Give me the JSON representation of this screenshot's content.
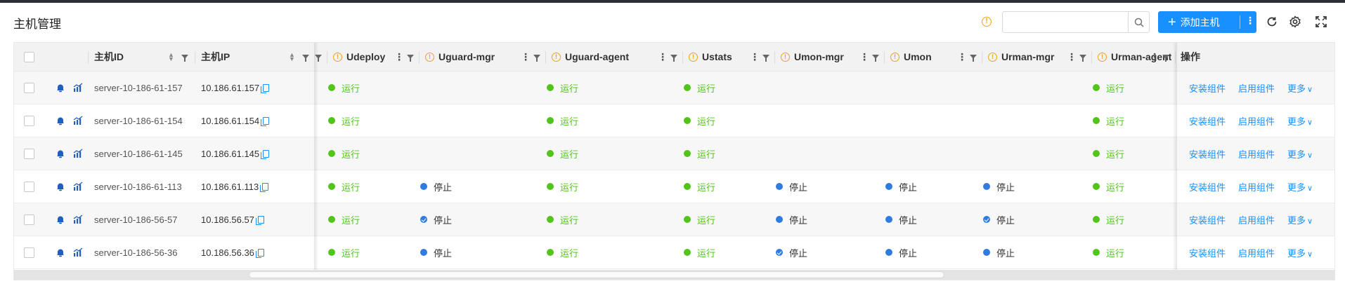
{
  "title": "主机管理",
  "toolbar": {
    "info_icon": "info-icon",
    "search": {
      "value": "",
      "placeholder": ""
    },
    "add_label": "添加主机",
    "add_more": "⋮"
  },
  "columns": {
    "host_id": "主机ID",
    "host_ip": "主机IP",
    "components": [
      "Udeploy",
      "Uguard-mgr",
      "Uguard-agent",
      "Ustats",
      "Umon-mgr",
      "Umon",
      "Urman-mgr",
      "Urman-agent"
    ],
    "actions": "操作"
  },
  "rows": [
    {
      "id": "server-10-186-61-157",
      "ip": "10.186.61.157",
      "status": [
        "运行",
        "",
        "运行",
        "运行",
        "",
        "",
        "",
        "运行"
      ],
      "kind": [
        "run",
        "",
        "run",
        "run",
        "",
        "",
        "",
        "run"
      ]
    },
    {
      "id": "server-10-186-61-154",
      "ip": "10.186.61.154",
      "status": [
        "运行",
        "",
        "运行",
        "运行",
        "",
        "",
        "",
        "运行"
      ],
      "kind": [
        "run",
        "",
        "run",
        "run",
        "",
        "",
        "",
        "run"
      ]
    },
    {
      "id": "server-10-186-61-145",
      "ip": "10.186.61.145",
      "status": [
        "运行",
        "",
        "运行",
        "运行",
        "",
        "",
        "",
        "运行"
      ],
      "kind": [
        "run",
        "",
        "run",
        "run",
        "",
        "",
        "",
        "run"
      ]
    },
    {
      "id": "server-10-186-61-113",
      "ip": "10.186.61.113",
      "status": [
        "运行",
        "停止",
        "运行",
        "运行",
        "停止",
        "停止",
        "停止",
        "运行"
      ],
      "kind": [
        "run",
        "stop",
        "run",
        "run",
        "stop",
        "stop",
        "stop",
        "run"
      ]
    },
    {
      "id": "server-10-186-56-57",
      "ip": "10.186.56.57",
      "status": [
        "运行",
        "停止",
        "运行",
        "运行",
        "停止",
        "停止",
        "停止",
        "运行"
      ],
      "kind": [
        "run",
        "check",
        "run",
        "run",
        "stop",
        "stop",
        "check",
        "run"
      ]
    },
    {
      "id": "server-10-186-56-36",
      "ip": "10.186.56.36",
      "status": [
        "运行",
        "停止",
        "运行",
        "运行",
        "停止",
        "停止",
        "停止",
        "运行"
      ],
      "kind": [
        "run",
        "stop",
        "run",
        "run",
        "check",
        "stop",
        "stop",
        "run"
      ]
    }
  ],
  "row_actions": {
    "install": "安装组件",
    "enable": "启用组件",
    "more": "更多"
  },
  "colors": {
    "primary": "#1890ff",
    "running": "#52c41a",
    "stopped": "#2f7be0",
    "info": "#f0a020"
  }
}
